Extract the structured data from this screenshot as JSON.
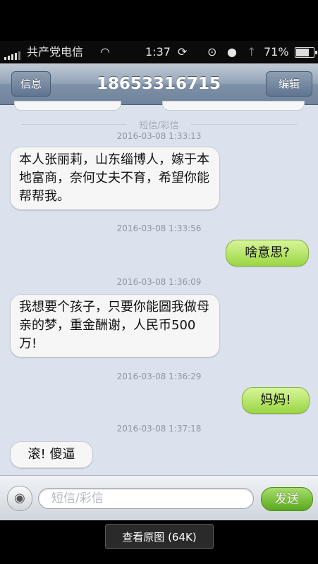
{
  "status_bar": {
    "carrier": "共产党电信",
    "time": "1:37",
    "battery": "71%"
  },
  "nav": {
    "back_label": "信息",
    "title": "18653316715",
    "edit_label": "编辑"
  },
  "chat": {
    "separator": "短信/彩信",
    "messages": [
      {
        "timestamp": "2016-03-08 1:33:13",
        "direction": "incoming",
        "text": "本人张丽莉，山东缁博人，嫁于本地富商，奈何丈夫不育，希望你能帮帮我。"
      },
      {
        "timestamp": "2016-03-08 1:33:56",
        "direction": "outgoing",
        "text": "啥意思?"
      },
      {
        "timestamp": "2016-03-08 1:36:09",
        "direction": "incoming",
        "text": "我想要个孩子，只要你能圆我做母亲的梦，重金酬谢，人民币500万!"
      },
      {
        "timestamp": "2016-03-08 1:36:29",
        "direction": "outgoing",
        "text": "妈妈!"
      },
      {
        "timestamp": "2016-03-08 1:37:18",
        "direction": "incoming",
        "text": "滚! 傻逼"
      }
    ]
  },
  "input_bar": {
    "placeholder": "短信/彩信",
    "send_label": "发送"
  },
  "viewer": {
    "view_original_label": "查看原图 (64K)"
  }
}
